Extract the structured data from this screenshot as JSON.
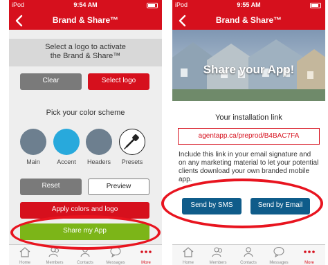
{
  "left": {
    "status": {
      "carrier": "iPod",
      "time": "9:54 AM"
    },
    "title": "Brand & Share™",
    "banner": {
      "line1": "Select a logo to activate",
      "line2": "the Brand & Share™"
    },
    "clear_label": "Clear",
    "select_logo_label": "Select logo",
    "color_heading": "Pick your color scheme",
    "swatches": [
      {
        "label": "Main",
        "color": "#6d7f8f"
      },
      {
        "label": "Accent",
        "color": "#28a9dc"
      },
      {
        "label": "Headers",
        "color": "#6d7f8f"
      },
      {
        "label": "Presets",
        "color": "#ffffff"
      }
    ],
    "reset_label": "Reset",
    "preview_label": "Preview",
    "apply_label": "Apply colors and logo",
    "share_label": "Share my App"
  },
  "right": {
    "status": {
      "carrier": "iPod",
      "time": "9:55 AM"
    },
    "title": "Brand & Share™",
    "hero_title": "Share your App!",
    "install_label": "Your installation link",
    "link": "agentapp.ca/preprod/B4BAC7FA",
    "description": "Include this link in your email signature and on any marketing material to let your potential clients download your own branded mobile app.",
    "sms_label": "Send by SMS",
    "email_label": "Send by Email"
  },
  "tabs": [
    {
      "label": "Home",
      "icon": "home-icon"
    },
    {
      "label": "Members",
      "icon": "members-icon"
    },
    {
      "label": "Contacts",
      "icon": "contacts-icon"
    },
    {
      "label": "Messages",
      "icon": "messages-icon"
    },
    {
      "label": "More",
      "icon": "more-icon"
    }
  ],
  "colors": {
    "brand_red": "#d6101d",
    "share_green": "#7cb518",
    "send_blue": "#0f5c8a",
    "highlight_ellipse": "#e8141f"
  }
}
